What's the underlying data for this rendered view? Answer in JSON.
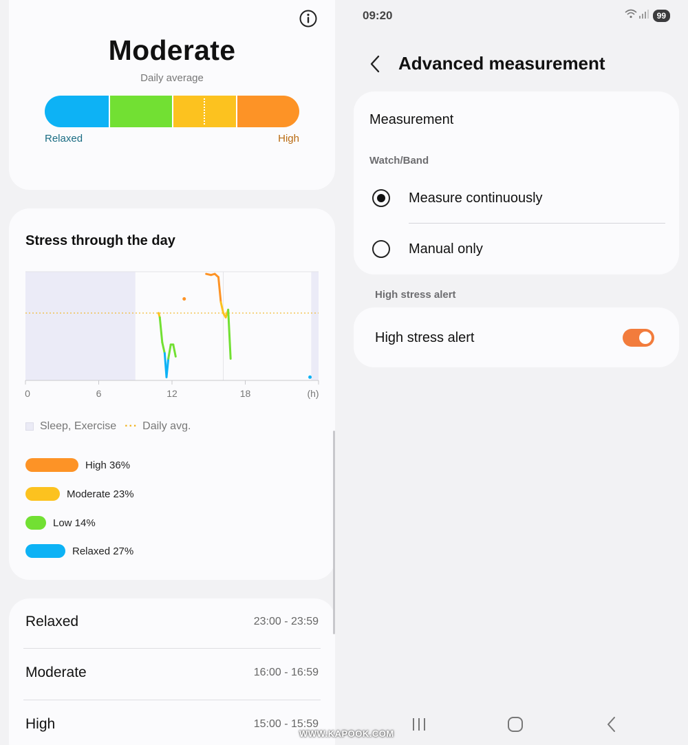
{
  "left": {
    "summary": {
      "title": "Moderate",
      "subtitle": "Daily average",
      "bar_left_label": "Relaxed",
      "bar_right_label": "High",
      "daily_avg_fraction": 0.63,
      "segments": [
        {
          "name": "Relaxed",
          "color": "#0db2f5"
        },
        {
          "name": "Low",
          "color": "#72e033"
        },
        {
          "name": "Moderate",
          "color": "#fcc21f"
        },
        {
          "name": "High",
          "color": "#fd9326"
        }
      ]
    },
    "chart_card": {
      "title": "Stress through the day",
      "legend_sleep": "Sleep, Exercise",
      "legend_avg": "Daily avg.",
      "breakdown": [
        {
          "label": "High 36%",
          "percent": 36,
          "color": "#fd9326"
        },
        {
          "label": "Moderate 23%",
          "percent": 23,
          "color": "#fcc21f"
        },
        {
          "label": "Low 14%",
          "percent": 14,
          "color": "#72e033"
        },
        {
          "label": "Relaxed 27%",
          "percent": 27,
          "color": "#0db2f5"
        }
      ]
    },
    "ranges": [
      {
        "label": "Relaxed",
        "time": "23:00 - 23:59"
      },
      {
        "label": "Moderate",
        "time": "16:00 - 16:59"
      },
      {
        "label": "High",
        "time": "15:00 - 15:59"
      }
    ]
  },
  "chart_data": {
    "type": "line",
    "title": "Stress through the day",
    "xlabel": "(h)",
    "ylabel": "",
    "xlim": [
      0,
      24
    ],
    "ylim": [
      0,
      100
    ],
    "x_ticks": [
      "0",
      "6",
      "12",
      "18"
    ],
    "x_tick_values": [
      0,
      6,
      12,
      18
    ],
    "x_unit_label": "(h)",
    "grid": false,
    "daily_avg": 62,
    "shaded_intervals": [
      [
        0,
        9
      ],
      [
        23.4,
        24
      ]
    ],
    "series": [
      {
        "points": [
          [
            10.9,
            62
          ],
          [
            11.0,
            58
          ],
          [
            11.2,
            35
          ],
          [
            11.4,
            25
          ],
          [
            11.55,
            3
          ],
          [
            11.7,
            20
          ],
          [
            11.9,
            33
          ],
          [
            12.1,
            33
          ],
          [
            12.3,
            22
          ]
        ]
      },
      {
        "points": [
          [
            13.0,
            75
          ]
        ]
      },
      {
        "points": [
          [
            14.8,
            98
          ],
          [
            15.2,
            97
          ],
          [
            15.5,
            98
          ],
          [
            15.8,
            95
          ],
          [
            16.0,
            72
          ],
          [
            16.2,
            62
          ],
          [
            16.4,
            58
          ],
          [
            16.6,
            65
          ],
          [
            16.8,
            20
          ]
        ]
      },
      {
        "points": [
          [
            23.3,
            3
          ]
        ]
      }
    ]
  },
  "right": {
    "status_time": "09:20",
    "battery": "99",
    "page_title": "Advanced measurement",
    "measurement": {
      "header": "Measurement",
      "subheader": "Watch/Band",
      "options": [
        "Measure continuously",
        "Manual only"
      ],
      "selected_index": 0
    },
    "alert_section_label": "High stress alert",
    "alert_row_label": "High stress alert",
    "alert_enabled": true,
    "toggle_color": "#f27c3c"
  },
  "watermark": "WWW.KAPOOK.COM"
}
